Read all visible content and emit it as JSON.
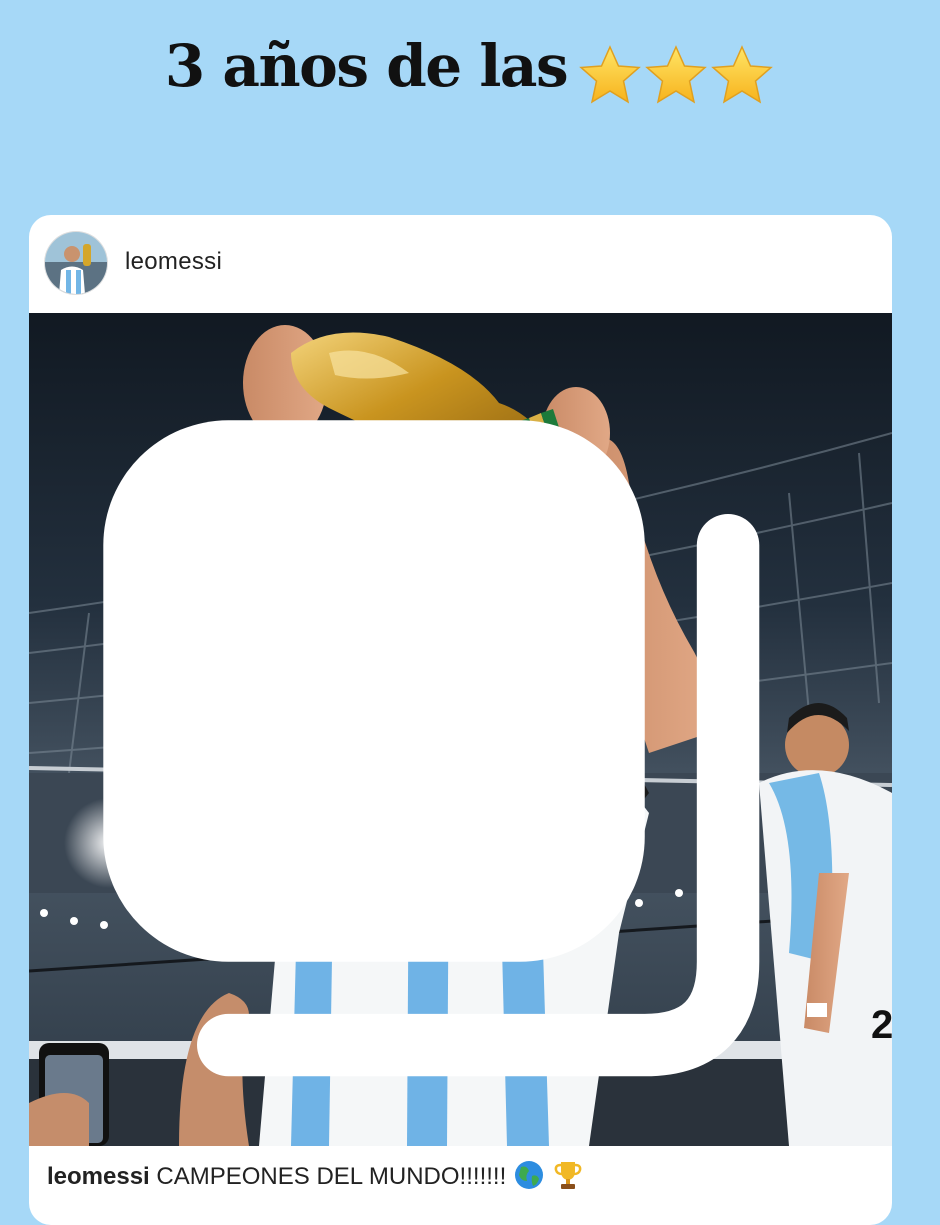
{
  "headline": {
    "text": "3 años de las",
    "stars_count": 3,
    "star_icon": "star-emoji"
  },
  "post": {
    "username": "leomessi",
    "avatar_icon": "profile-avatar",
    "multi_photo_icon": "carousel-icon",
    "caption_user": "leomessi",
    "caption_text": "CAMPEONES DEL MUNDO!!!!!!!",
    "caption_emojis": [
      "globe-emoji",
      "trophy-emoji"
    ]
  },
  "colors": {
    "background": "#a6d8f7",
    "card": "#ffffff",
    "jersey_blue": "#6fb3e6",
    "trophy_gold": "#d4a62a"
  }
}
